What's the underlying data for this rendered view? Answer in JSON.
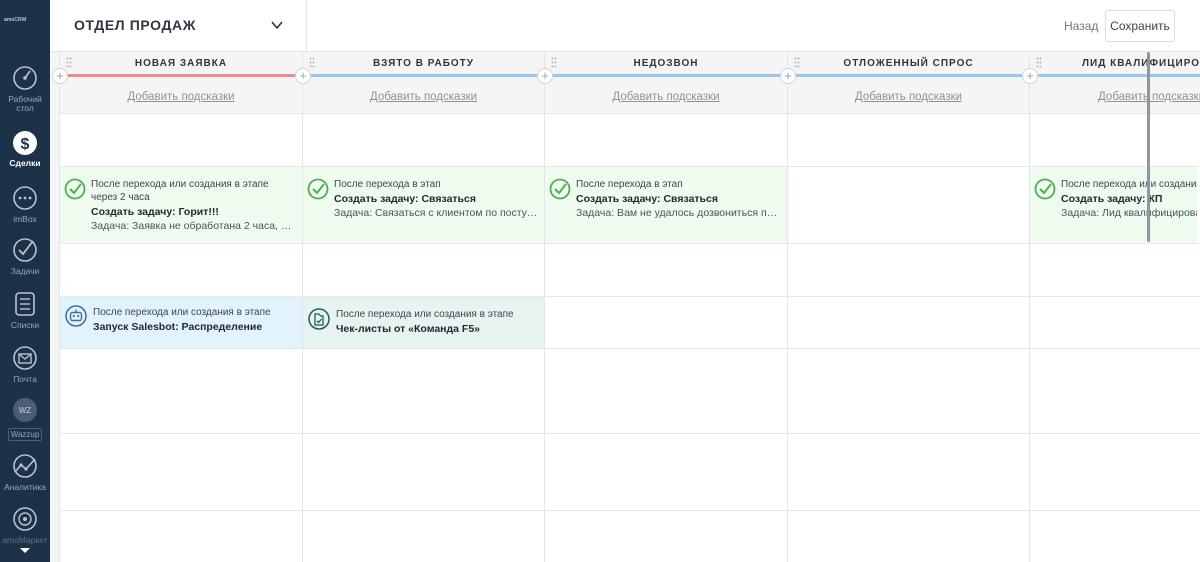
{
  "sidebar": {
    "logo_text": "amoCRM",
    "items": [
      {
        "label": "Рабочий стол",
        "icon": "dashboard-icon"
      },
      {
        "label": "Сделки",
        "icon": "deals-icon",
        "active": true
      },
      {
        "label": "imBox",
        "icon": "chat-icon"
      },
      {
        "label": "Задачи",
        "icon": "tasks-icon"
      },
      {
        "label": "Списки",
        "icon": "lists-icon"
      },
      {
        "label": "Почта",
        "icon": "mail-icon"
      },
      {
        "label": "WZ",
        "tag": "Wazzup",
        "icon": "wazzup-icon"
      },
      {
        "label": "Аналитика",
        "icon": "analytics-icon"
      },
      {
        "label": "amoМаркет",
        "icon": "market-icon"
      }
    ]
  },
  "header": {
    "pipeline_title": "ОТДЕЛ ПРОДАЖ",
    "back_label": "Назад",
    "save_label": "Сохранить"
  },
  "columns": [
    {
      "name": "НОВАЯ ЗАЯВКА",
      "color": "#f28b91",
      "hint": "Добавить подсказки"
    },
    {
      "name": "ВЗЯТО В РАБОТУ",
      "color": "#99c7f0",
      "hint": "Добавить подсказки"
    },
    {
      "name": "НЕДОЗВОН",
      "color": "#99c7f0",
      "hint": "Добавить подсказки"
    },
    {
      "name": "ОТЛОЖЕННЫЙ СПРОС",
      "color": "#99c7f0",
      "hint": "Добавить подсказки"
    },
    {
      "name": "ЛИД КВАЛИФИЦИРОВАН",
      "color": "#99c7f0",
      "hint": "Добавить подсказки"
    }
  ],
  "task_triggers": [
    {
      "column": 0,
      "condition": "После перехода или создания в этапе через 2 часа",
      "title": "Создать задачу: Горит!!!",
      "desc": "Задача: Заявка не обработана 2 часа, пе..."
    },
    {
      "column": 1,
      "condition": "После перехода в этап",
      "title": "Создать задачу: Связаться",
      "desc": "Задача: Связаться с клиентом по поступ..."
    },
    {
      "column": 2,
      "condition": "После перехода в этап",
      "title": "Создать задачу: Связаться",
      "desc": "Задача: Вам не удалось дозвониться по ..."
    },
    {
      "column": 4,
      "condition": "После перехода или создания в этапе",
      "title": "Создать задачу: КП",
      "desc": "Задача: Лид квалифицирован"
    }
  ],
  "bot_triggers": [
    {
      "column": 0,
      "condition": "После перехода или создания в этапе",
      "title": "Запуск Salesbot: Распределение",
      "icon": "robot-icon"
    },
    {
      "column": 1,
      "condition": "После перехода или создания в этапе",
      "title": "Чек-листы от «Команда F5»",
      "icon": "checklist-widget-icon"
    }
  ],
  "colors": {
    "sidebar_bg": "#1b3248",
    "trigger_green": "#f0fbf0",
    "trigger_blue": "#e3f3fb",
    "trigger_mint": "#e6f3f0",
    "check_green": "#4caf50",
    "stage_red": "#f28b91",
    "stage_blue": "#99c7f0"
  }
}
